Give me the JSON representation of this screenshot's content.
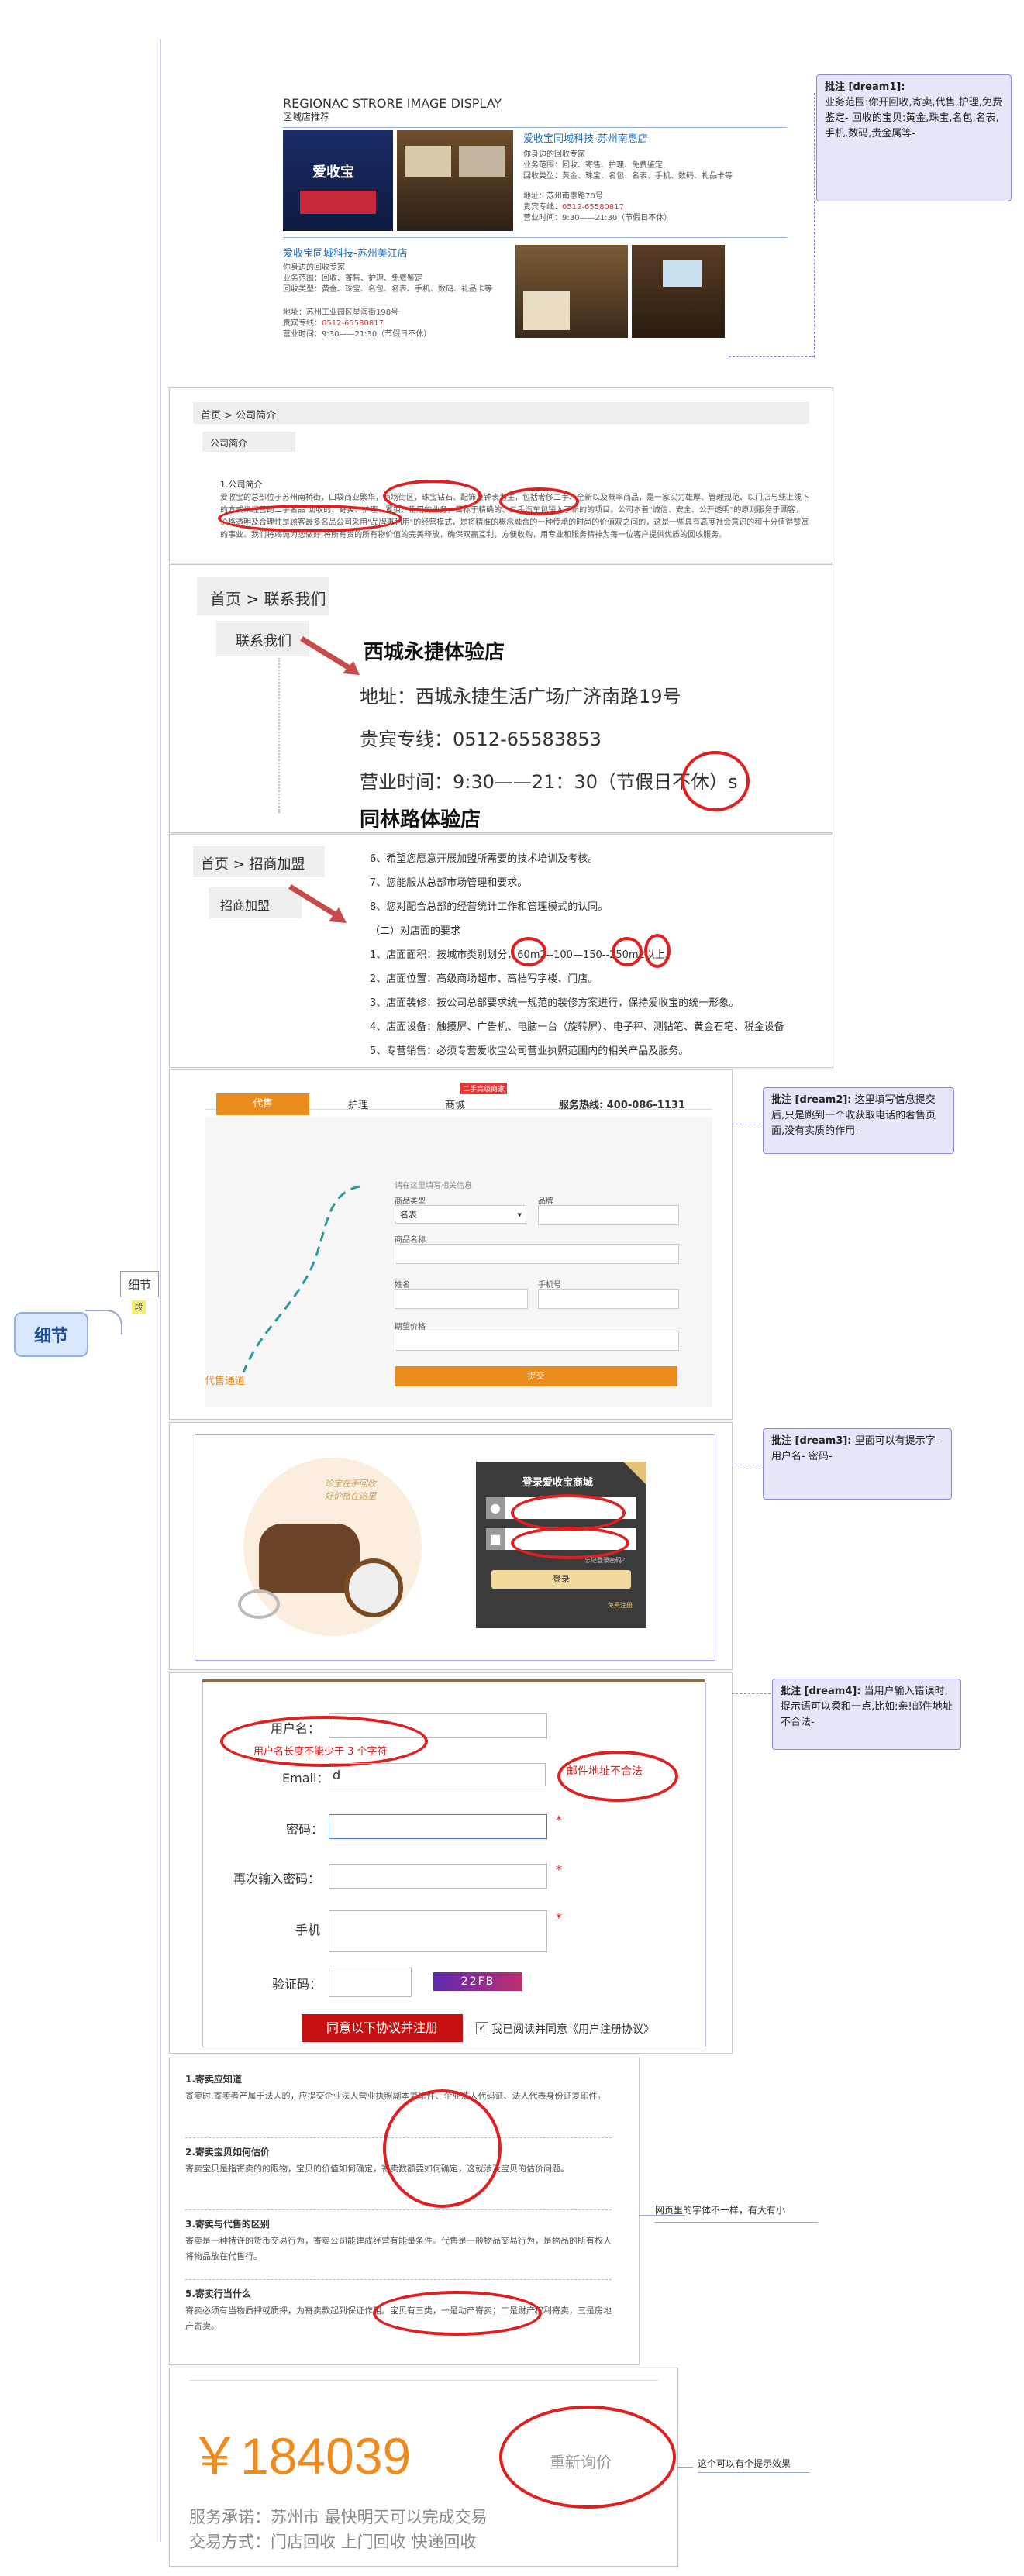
{
  "mindmap": {
    "root_label": "细节",
    "branch_label": "细节",
    "branch_badge": "段"
  },
  "panel1": {
    "heading_en": "REGIONAC STRORE IMAGE DISPLAY",
    "heading_cn": "区域店推荐",
    "store1": {
      "name": "爱收宝同城科技-苏州南惠店",
      "tagline": "你身边的回收专家",
      "scope_label": "业务范围：",
      "scope": "回收、寄售、护理、免费鉴定",
      "goods_label": "回收类型：",
      "goods": "黄金、珠宝、名包、名表、手机、数码、礼品卡等",
      "addr_label": "地址：",
      "addr": "苏州南惠路70号",
      "tel_label": "贵宾专线：",
      "tel": "0512-65580817",
      "hours_label": "营业时间：",
      "hours": "9:30——21:30（节假日不休）"
    },
    "store2": {
      "name": "爱收宝同城科技-苏州美江店",
      "tagline": "你身边的回收专家",
      "scope_label": "业务范围：",
      "scope": "回收、寄售、护理、免费鉴定",
      "goods_label": "回收类型：",
      "goods": "黄金、珠宝、名包、名表、手机、数码、礼品卡等",
      "addr_label": "地址：",
      "addr": "苏州工业园区星海街198号",
      "tel_label": "贵宾专线：",
      "tel": "0512-65580817",
      "hours_label": "营业时间：",
      "hours": "9:30——21:30（节假日不休）"
    },
    "logo_text": "爱收宝",
    "note": {
      "title": "批注 [dream1]:",
      "body": "业务范围:你开回收,寄卖,代售,护理,免费鉴定- 回收的宝贝:黄金,珠宝,名包,名表,手机,数码,贵金属等-"
    }
  },
  "panel2": {
    "breadcrumb": "首页 > 公司简介",
    "tab": "公司简介",
    "section": "1.公司简介",
    "para1": "爱收宝的总部位于苏州南桥街，口袋商业繁华，商场街区，珠宝钻石、配饰及钟表为主，包括奢侈二手、全新以及概率商品，是一家实力雄厚、管理规范、以门店与线上线下的方式来经营的二手名品",
    "para2": "回收的、寄卖、护理、置换、租用的业务，目标于精确的、二手汽车包销入了新的的项目。公司本着\"诚信、安全、公开透明\"的原则服务于顾客，价格透明及合理性是顾客最多名品公司采用\"品牌再利用\"的经营模式，是将精准的概念融合的一种传承的时尚的价值观之间的，这是一些具有高度社会意识的和十分值得赞赏的事业。我们将竭诚为您做好",
    "para3": "将所有贵的所有物价值的完美释放，确保双赢互利，方便收购，用专业和服务精神为每一位客户提供优质的回收服务。"
  },
  "panel3": {
    "breadcrumb": "首页 > 联系我们",
    "tab": "联系我们",
    "store1_title": "西城永捷体验店",
    "addr": "地址：西城永捷生活广场广济南路19号",
    "tel": "贵宾专线：0512-65583853",
    "hours": "营业时间：9:30——21：30（节假日不休）s",
    "store2_title": "同林路体验店"
  },
  "panel4": {
    "breadcrumb": "首页 > 招商加盟",
    "tab": "招商加盟",
    "items": [
      "6、希望您愿意开展加盟所需要的技术培训及考核。",
      "7、您能服从总部市场管理和要求。",
      "8、您对配合总部的经营统计工作和管理模式的认同。",
      "（二）对店面的要求",
      "1、店面面积：按城市类别划分，60m2--100—150--250m2以上。",
      "2、店面位置：高级商场超市、高档写字楼、门店。",
      "3、店面装修：按公司总部要求统一规范的装修方案进行，保持爱收宝的统一形象。",
      "4、店面设备：触摸屏、广告机、电脑一台（旋转屏）、电子秤、测钻笔、黄金石笔、税金设备",
      "5、专营销售：必须专营爱收宝公司营业执照范围内的相关产品及服务。"
    ]
  },
  "panel5": {
    "tabs": [
      "代售",
      "护理",
      "商城"
    ],
    "tab_badge": "二手高级商家",
    "hotline": "服务热线: 400-086-1131",
    "form_title": "请在这里填写相关信息",
    "fields": [
      "商品类型",
      "品牌",
      "商品名称",
      "姓名",
      "手机号",
      "期望价格"
    ],
    "select_value": "名表",
    "submit": "提交",
    "channel": "代售通道",
    "note": {
      "title": "批注 [dream2]:",
      "body": "这里填写信息提交后,只是跳到一个收获取电话的奢售页面,没有实质的作用-"
    }
  },
  "panel6": {
    "promo_text": "珍宝在手回收\n好价格在这里",
    "login_title": "登录爱收宝商城",
    "forgot": "忘记登录密码？",
    "login_btn": "登录",
    "register": "免费注册",
    "note": {
      "title": "批注 [dream3]:",
      "body": "里面可以有提示字- 用户名- 密码-"
    }
  },
  "panel7": {
    "username_label": "用户名：",
    "username_hint": "用户名长度不能少于 3 个字符",
    "email_label": "Email：",
    "email_value": "d",
    "email_error": "邮件地址不合法",
    "password_label": "密码：",
    "confirm_label": "再次输入密码：",
    "phone_label": "手机",
    "captcha_label": "验证码：",
    "captcha": "22FB",
    "required_mark": "*",
    "submit": "同意以下协议并注册",
    "agree": "我已阅读并同意《用户注册协议》",
    "note": {
      "title": "批注 [dream4]:",
      "body": "当用户输入错误时,提示语可以柔和一点,比如:亲!邮件地址不合法-"
    }
  },
  "panel8": {
    "sections": [
      {
        "title": "1.寄卖应知道",
        "body": "寄卖时,寄卖者产属于法人的，应提交企业法人营业执照副本复印件、企业法人代码证、法人代表身份证复印件。"
      },
      {
        "title": "2.寄卖宝贝如何估价",
        "body": "寄卖宝贝是指寄卖的的限物，宝贝的价值如何确定，寄卖数额要如何确定，这就涉及宝贝的估价问题。"
      },
      {
        "title": "3.寄卖与代售的区别",
        "body": "寄卖是一种特许的货币交易行为，寄卖公司能建成经营有能量条件。代售是一般物品交易行为，是物品的所有权人将物品放在代售行。"
      },
      {
        "title": "5.寄卖行当什么",
        "body": "寄卖必须有当物质押或质押，为寄卖款起到保证作用。宝贝有三类，一是动产寄卖；二是财产权利寄卖，三是房地产寄卖。"
      }
    ],
    "note": "网页里的字体不一样，有大有小"
  },
  "panel9": {
    "price": "￥184039",
    "requery": "重新询价",
    "line1": "服务承诺：苏州市   最快明天可以完成交易",
    "line2": "交易方式：门店回收   上门回收   快递回收",
    "note": "这个可以有个提示效果"
  }
}
